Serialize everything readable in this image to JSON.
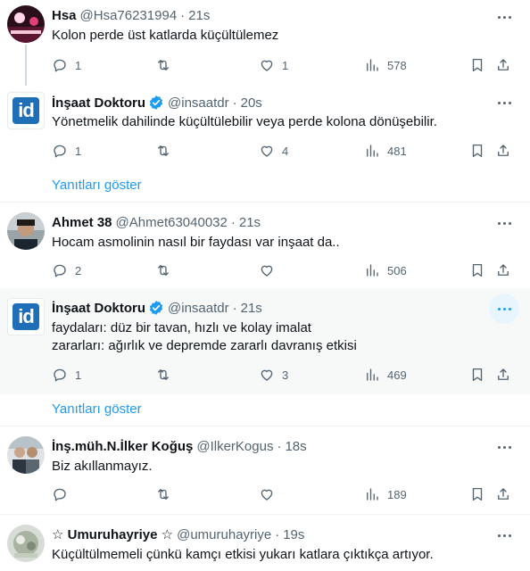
{
  "colors": {
    "accent": "#1d9bf0",
    "verified": "#1d9bf0",
    "muted": "#536471",
    "text": "#0f1419",
    "hover_bg": "#f7f9f9"
  },
  "tweets": [
    {
      "name": "Hsa",
      "handle": "@Hsa76231994",
      "separator": "·",
      "time": "21s",
      "verified": false,
      "text": [
        "Kolon perde üst katlarda küçültülemez"
      ],
      "reply_count": "1",
      "retweet_count": "",
      "like_count": "1",
      "view_count": "578"
    },
    {
      "name": "İnşaat Doktoru",
      "handle": "@insaatdr",
      "separator": "·",
      "time": "20s",
      "verified": true,
      "avatar_text": "id",
      "text": [
        "Yönetmelik dahilinde küçültülebilir veya perde kolona dönüşebilir."
      ],
      "reply_count": "1",
      "retweet_count": "",
      "like_count": "4",
      "view_count": "481"
    },
    {
      "name": "Ahmet 38",
      "handle": "@Ahmet63040032",
      "separator": "·",
      "time": "21s",
      "verified": false,
      "text": [
        "Hocam asmolinin nasıl bir faydası var inşaat da.."
      ],
      "reply_count": "2",
      "retweet_count": "",
      "like_count": "",
      "view_count": "506"
    },
    {
      "name": "İnşaat Doktoru",
      "handle": "@insaatdr",
      "separator": "·",
      "time": "21s",
      "verified": true,
      "avatar_text": "id",
      "text": [
        "faydaları: düz bir tavan, hızlı ve kolay imalat",
        "zararları: ağırlık ve depremde zararlı davranış etkisi"
      ],
      "reply_count": "1",
      "retweet_count": "",
      "like_count": "3",
      "view_count": "469"
    },
    {
      "name": "İnş.müh.N.İlker Koğuş",
      "handle": "@IlkerKogus",
      "separator": "·",
      "time": "18s",
      "verified": false,
      "text": [
        "Biz akıllanmayız."
      ],
      "reply_count": "",
      "retweet_count": "",
      "like_count": "",
      "view_count": "189"
    },
    {
      "name": "☆ Umuruhayriye ☆",
      "handle": "@umuruhayriye",
      "separator": "·",
      "time": "19s",
      "verified": false,
      "text": [
        "Küçültülmemeli çünkü kamçı etkisi yukarı katlara çıktıkça artıyor."
      ],
      "reply_count": "",
      "retweet_count": "",
      "like_count": "",
      "view_count": ""
    }
  ],
  "show_replies_label": "Yanıtları göster"
}
